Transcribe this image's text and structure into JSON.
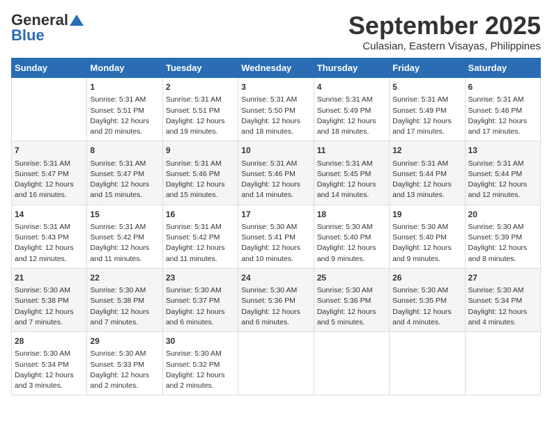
{
  "header": {
    "logo_general": "General",
    "logo_blue": "Blue",
    "month": "September 2025",
    "location": "Culasian, Eastern Visayas, Philippines"
  },
  "days_of_week": [
    "Sunday",
    "Monday",
    "Tuesday",
    "Wednesday",
    "Thursday",
    "Friday",
    "Saturday"
  ],
  "weeks": [
    [
      {
        "day": "",
        "info": ""
      },
      {
        "day": "1",
        "info": "Sunrise: 5:31 AM\nSunset: 5:51 PM\nDaylight: 12 hours\nand 20 minutes."
      },
      {
        "day": "2",
        "info": "Sunrise: 5:31 AM\nSunset: 5:51 PM\nDaylight: 12 hours\nand 19 minutes."
      },
      {
        "day": "3",
        "info": "Sunrise: 5:31 AM\nSunset: 5:50 PM\nDaylight: 12 hours\nand 18 minutes."
      },
      {
        "day": "4",
        "info": "Sunrise: 5:31 AM\nSunset: 5:49 PM\nDaylight: 12 hours\nand 18 minutes."
      },
      {
        "day": "5",
        "info": "Sunrise: 5:31 AM\nSunset: 5:49 PM\nDaylight: 12 hours\nand 17 minutes."
      },
      {
        "day": "6",
        "info": "Sunrise: 5:31 AM\nSunset: 5:48 PM\nDaylight: 12 hours\nand 17 minutes."
      }
    ],
    [
      {
        "day": "7",
        "info": "Sunrise: 5:31 AM\nSunset: 5:47 PM\nDaylight: 12 hours\nand 16 minutes."
      },
      {
        "day": "8",
        "info": "Sunrise: 5:31 AM\nSunset: 5:47 PM\nDaylight: 12 hours\nand 15 minutes."
      },
      {
        "day": "9",
        "info": "Sunrise: 5:31 AM\nSunset: 5:46 PM\nDaylight: 12 hours\nand 15 minutes."
      },
      {
        "day": "10",
        "info": "Sunrise: 5:31 AM\nSunset: 5:46 PM\nDaylight: 12 hours\nand 14 minutes."
      },
      {
        "day": "11",
        "info": "Sunrise: 5:31 AM\nSunset: 5:45 PM\nDaylight: 12 hours\nand 14 minutes."
      },
      {
        "day": "12",
        "info": "Sunrise: 5:31 AM\nSunset: 5:44 PM\nDaylight: 12 hours\nand 13 minutes."
      },
      {
        "day": "13",
        "info": "Sunrise: 5:31 AM\nSunset: 5:44 PM\nDaylight: 12 hours\nand 12 minutes."
      }
    ],
    [
      {
        "day": "14",
        "info": "Sunrise: 5:31 AM\nSunset: 5:43 PM\nDaylight: 12 hours\nand 12 minutes."
      },
      {
        "day": "15",
        "info": "Sunrise: 5:31 AM\nSunset: 5:42 PM\nDaylight: 12 hours\nand 11 minutes."
      },
      {
        "day": "16",
        "info": "Sunrise: 5:31 AM\nSunset: 5:42 PM\nDaylight: 12 hours\nand 11 minutes."
      },
      {
        "day": "17",
        "info": "Sunrise: 5:30 AM\nSunset: 5:41 PM\nDaylight: 12 hours\nand 10 minutes."
      },
      {
        "day": "18",
        "info": "Sunrise: 5:30 AM\nSunset: 5:40 PM\nDaylight: 12 hours\nand 9 minutes."
      },
      {
        "day": "19",
        "info": "Sunrise: 5:30 AM\nSunset: 5:40 PM\nDaylight: 12 hours\nand 9 minutes."
      },
      {
        "day": "20",
        "info": "Sunrise: 5:30 AM\nSunset: 5:39 PM\nDaylight: 12 hours\nand 8 minutes."
      }
    ],
    [
      {
        "day": "21",
        "info": "Sunrise: 5:30 AM\nSunset: 5:38 PM\nDaylight: 12 hours\nand 7 minutes."
      },
      {
        "day": "22",
        "info": "Sunrise: 5:30 AM\nSunset: 5:38 PM\nDaylight: 12 hours\nand 7 minutes."
      },
      {
        "day": "23",
        "info": "Sunrise: 5:30 AM\nSunset: 5:37 PM\nDaylight: 12 hours\nand 6 minutes."
      },
      {
        "day": "24",
        "info": "Sunrise: 5:30 AM\nSunset: 5:36 PM\nDaylight: 12 hours\nand 6 minutes."
      },
      {
        "day": "25",
        "info": "Sunrise: 5:30 AM\nSunset: 5:36 PM\nDaylight: 12 hours\nand 5 minutes."
      },
      {
        "day": "26",
        "info": "Sunrise: 5:30 AM\nSunset: 5:35 PM\nDaylight: 12 hours\nand 4 minutes."
      },
      {
        "day": "27",
        "info": "Sunrise: 5:30 AM\nSunset: 5:34 PM\nDaylight: 12 hours\nand 4 minutes."
      }
    ],
    [
      {
        "day": "28",
        "info": "Sunrise: 5:30 AM\nSunset: 5:34 PM\nDaylight: 12 hours\nand 3 minutes."
      },
      {
        "day": "29",
        "info": "Sunrise: 5:30 AM\nSunset: 5:33 PM\nDaylight: 12 hours\nand 2 minutes."
      },
      {
        "day": "30",
        "info": "Sunrise: 5:30 AM\nSunset: 5:32 PM\nDaylight: 12 hours\nand 2 minutes."
      },
      {
        "day": "",
        "info": ""
      },
      {
        "day": "",
        "info": ""
      },
      {
        "day": "",
        "info": ""
      },
      {
        "day": "",
        "info": ""
      }
    ]
  ]
}
